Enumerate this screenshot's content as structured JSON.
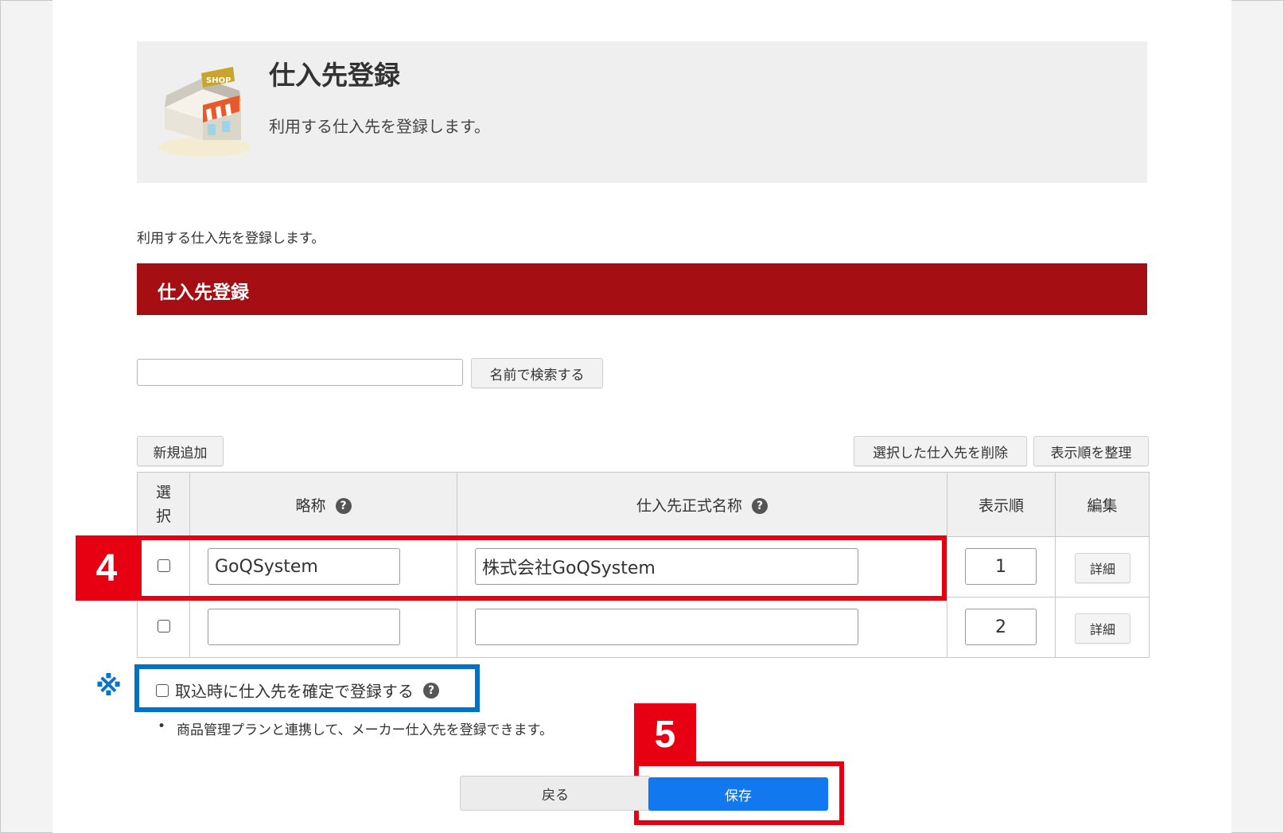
{
  "header": {
    "title": "仕入先登録",
    "description": "利用する仕入先を登録します。",
    "icon": "shop-icon",
    "icon_sign": "SHOP"
  },
  "intro_text": "利用する仕入先を登録します。",
  "section": {
    "title": "仕入先登録",
    "color": "#a50f13"
  },
  "search": {
    "value": "",
    "placeholder": "",
    "button_label": "名前で検索する"
  },
  "toolbar": {
    "add_label": "新規追加",
    "delete_label": "選択した仕入先を削除",
    "reorder_label": "表示順を整理"
  },
  "table": {
    "columns": {
      "select": "選択",
      "short_name": "略称",
      "official_name": "仕入先正式名称",
      "order": "表示順",
      "edit": "編集"
    },
    "help_icon": "?",
    "rows": [
      {
        "checked": false,
        "short_name": "GoQSystem",
        "official_name": "株式会社GoQSystem",
        "order": "1",
        "detail_label": "詳細"
      },
      {
        "checked": false,
        "short_name": "",
        "official_name": "",
        "order": "2",
        "detail_label": "詳細"
      }
    ]
  },
  "confirm_option": {
    "checked": false,
    "label": "取込時に仕入先を確定で登録する"
  },
  "note": "商品管理プランと連携して、メーカー仕入先を登録できます。",
  "note_mark": "※",
  "annotations": {
    "step4": "4",
    "step5": "5",
    "red": "#e60012",
    "blue": "#0072c6"
  },
  "actions": {
    "back_label": "戻る",
    "save_label": "保存",
    "save_color": "#1178f0"
  }
}
